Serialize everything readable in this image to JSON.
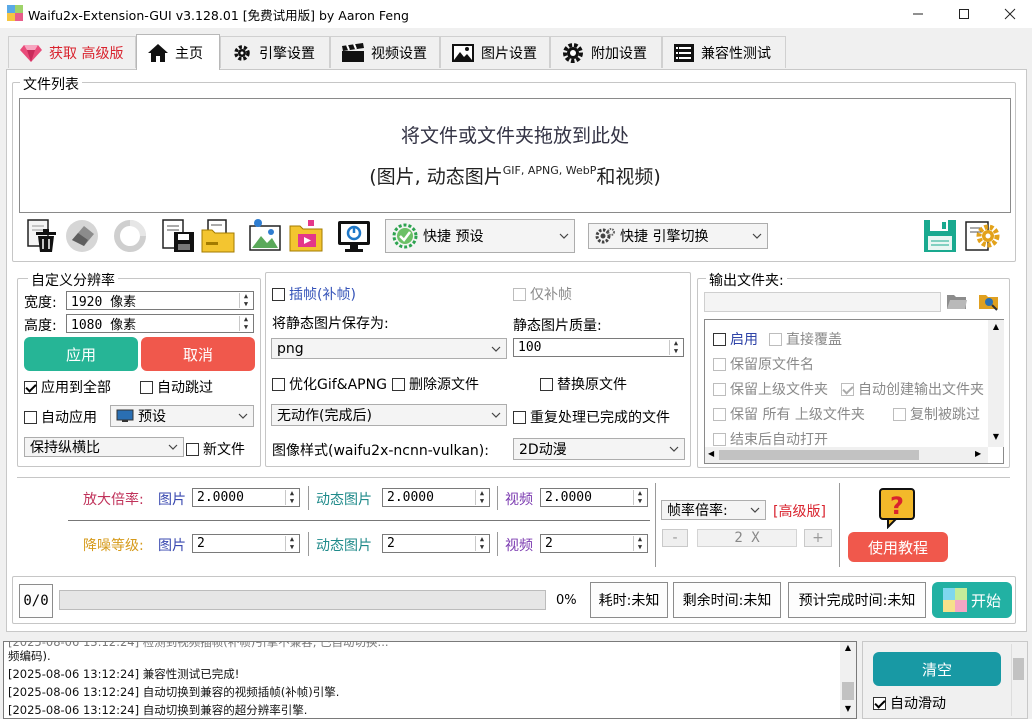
{
  "window": {
    "title": "Waifu2x-Extension-GUI v3.128.01 [免费试用版] by Aaron Feng",
    "controls": [
      "minimize",
      "maximize",
      "close"
    ]
  },
  "tabs": [
    {
      "label": "获取  高级版",
      "icon": "diamond-icon",
      "color": "#d9232e"
    },
    {
      "label": "主页",
      "icon": "home-icon",
      "active": true
    },
    {
      "label": "引擎设置",
      "icon": "engine-gear-icon"
    },
    {
      "label": "视频设置",
      "icon": "clapperboard-icon"
    },
    {
      "label": "图片设置",
      "icon": "picture-icon"
    },
    {
      "label": "附加设置",
      "icon": "addon-gear-icon"
    },
    {
      "label": "兼容性测试",
      "icon": "checklist-icon"
    }
  ],
  "file_list": {
    "title": "文件列表",
    "drop_line1": "将文件或文件夹拖放到此处",
    "drop_line2_pre": "(图片, 动态图片",
    "drop_sup1": "GIF, APNG, WebP",
    "drop_line2_post": "和视频)"
  },
  "toolbar": {
    "quick_preset_label": "快捷  预设",
    "quick_engine_label": "快捷  引擎切换"
  },
  "custom_res": {
    "title": "自定义分辨率",
    "width_label": "宽度:",
    "width_value": "1920 像素",
    "height_label": "高度:",
    "height_value": "1080 像素",
    "apply_label": "应用",
    "cancel_label": "取消",
    "apply_all_label": "应用到全部",
    "apply_all_checked": true,
    "auto_skip_label": "自动跳过",
    "auto_apply_label": "自动应用",
    "preset_value": "预设",
    "aspect_value": "保持纵横比",
    "new_file_label": "新文件"
  },
  "image_settings": {
    "interp_label": "插帧(补帧)",
    "interp_only_label": "仅补帧",
    "save_as_label": "将静态图片保存为:",
    "save_as_value": "png",
    "quality_label": "静态图片质量:",
    "quality_value": "100",
    "optimize_label": "优化Gif&APNG",
    "delete_src_label": "删除源文件",
    "replace_src_label": "替换原文件",
    "no_action_value": "无动作(完成后)",
    "reprocess_label": "重复处理已完成的文件",
    "style_label": "图像样式(waifu2x-ncnn-vulkan):",
    "style_value": "2D动漫"
  },
  "output_folder": {
    "title": "输出文件夹:",
    "path_value": "",
    "options": [
      {
        "label": "启用",
        "enabled": true,
        "checked": false
      },
      {
        "label": "直接覆盖",
        "enabled": false,
        "checked": false
      },
      {
        "label": "保留原文件名",
        "enabled": false,
        "checked": false
      },
      {
        "label": "保留上级文件夹",
        "enabled": false,
        "checked": false
      },
      {
        "label": "自动创建输出文件夹",
        "enabled": false,
        "checked": true
      },
      {
        "label": "保留 所有 上级文件夹",
        "enabled": false,
        "checked": false
      },
      {
        "label": "复制被跳过",
        "enabled": false,
        "checked": false
      },
      {
        "label": "结束后自动打开",
        "enabled": false,
        "checked": false
      }
    ]
  },
  "scale": {
    "scale_label": "放大倍率:",
    "scale_color": "#c0325a",
    "image_label": "图片",
    "image_value": "2.0000",
    "gif_label": "动态图片",
    "gif_value": "2.0000",
    "video_label": "视频",
    "video_value": "2.0000",
    "denoise_label": "降噪等级:",
    "denoise_color": "#d69a1a",
    "d_image_label": "图片",
    "d_image_value": "2",
    "d_gif_label": "动态图片",
    "d_gif_value": "2",
    "d_video_label": "视频",
    "d_video_value": "2",
    "image_color": "#3a49b0",
    "gif_color": "#1f8a8a",
    "video_color": "#7b3ab0"
  },
  "framerate": {
    "label": "帧率倍率:",
    "pro_label": "[高级版]",
    "minus": "-",
    "value": "2 X",
    "plus": "+"
  },
  "help": {
    "tutorial_label": "使用教程"
  },
  "progress": {
    "count": "0/0",
    "percent": "0%",
    "percent_value": 0,
    "elapsed": "耗时:未知",
    "remaining": "剩余时间:未知",
    "eta": "预计完成时间:未知",
    "start_label": "开始"
  },
  "log": {
    "lines": [
      "频编码).",
      "[2025-08-06 13:12:24] 兼容性测试已完成!",
      "[2025-08-06 13:12:24] 自动切换到兼容的视频插帧(补帧)引擎.",
      "[2025-08-06 13:12:24] 自动切换到兼容的超分辨率引擎."
    ],
    "clear_label": "清空",
    "autoscroll_label": "自动滑动",
    "autoscroll_checked": true
  }
}
